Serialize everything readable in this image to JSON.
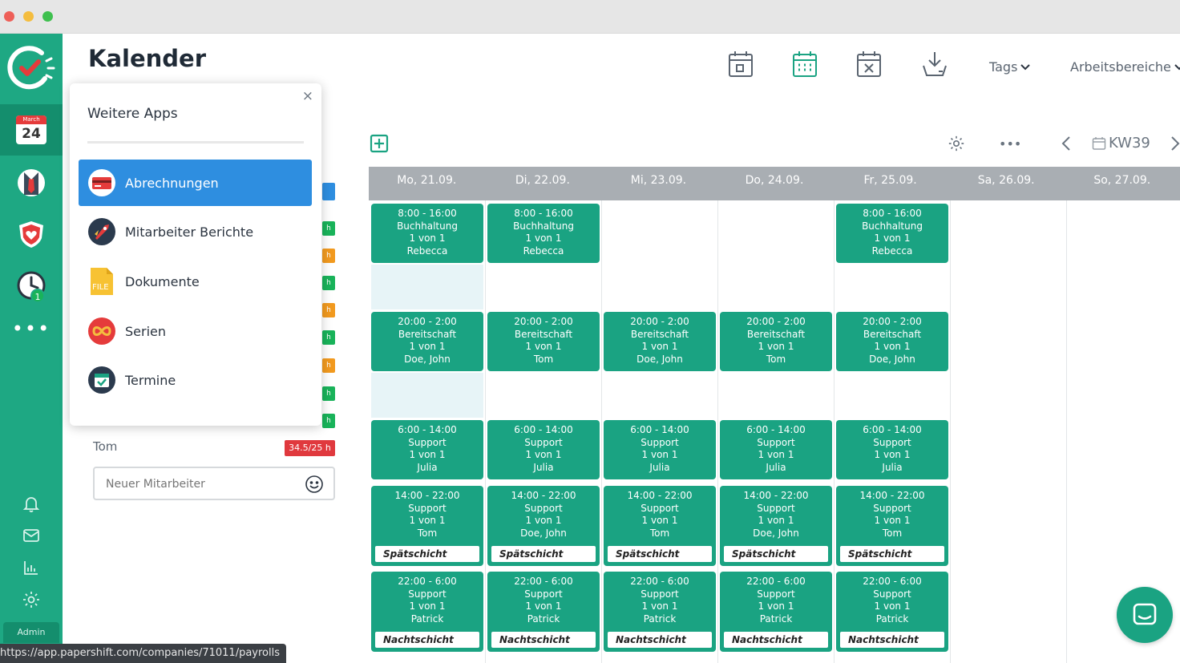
{
  "header": {
    "title": "Kalender",
    "tags_label": "Tags",
    "areas_label": "Arbeitsbereiche"
  },
  "sidebar": {
    "calendar_month": "March",
    "calendar_day": "24",
    "timer_badge": "1",
    "admin_label": "Admin"
  },
  "apps_panel": {
    "title": "Weitere Apps",
    "close": "×",
    "items": [
      {
        "label": "Abrechnungen",
        "icon": "credit-card-icon"
      },
      {
        "label": "Mitarbeiter Berichte",
        "icon": "rocket-icon"
      },
      {
        "label": "Dokumente",
        "icon": "file-icon"
      },
      {
        "label": "Serien",
        "icon": "infinity-icon"
      },
      {
        "label": "Termine",
        "icon": "calendar-check-icon"
      }
    ],
    "file_icon_text": "FILE"
  },
  "employees": {
    "visible_name": "Tom",
    "visible_hours": "34.5/25 h",
    "new_placeholder": "Neuer Mitarbeiter"
  },
  "calendar": {
    "week": "KW39",
    "days": [
      "Mo, 21.09.",
      "Di, 22.09.",
      "Mi, 23.09.",
      "Do, 24.09.",
      "Fr, 25.09.",
      "Sa, 26.09.",
      "So, 27.09."
    ],
    "rows": [
      {
        "time": "8:00 - 16:00",
        "name": "Buchhaltung",
        "tag": "",
        "cells": [
          {
            "count": "1 von 1",
            "person": "Rebecca"
          },
          {
            "count": "1 von 1",
            "person": "Rebecca"
          },
          null,
          null,
          {
            "count": "1 von 1",
            "person": "Rebecca"
          }
        ]
      },
      {
        "time": "20:00 - 2:00",
        "name": "Bereitschaft",
        "tag": "",
        "cells": [
          {
            "count": "1 von 1",
            "person": "Doe, John"
          },
          {
            "count": "1 von 1",
            "person": "Tom"
          },
          {
            "count": "1 von 1",
            "person": "Doe, John"
          },
          {
            "count": "1 von 1",
            "person": "Tom"
          },
          {
            "count": "1 von 1",
            "person": "Doe, John"
          }
        ]
      },
      {
        "time": "6:00 - 14:00",
        "name": "Support",
        "tag": "",
        "cells": [
          {
            "count": "1 von 1",
            "person": "Julia"
          },
          {
            "count": "1 von 1",
            "person": "Julia"
          },
          {
            "count": "1 von 1",
            "person": "Julia"
          },
          {
            "count": "1 von 1",
            "person": "Julia"
          },
          {
            "count": "1 von 1",
            "person": "Julia"
          }
        ]
      },
      {
        "time": "14:00 - 22:00",
        "name": "Support",
        "tag": "Spätschicht",
        "cells": [
          {
            "count": "1 von 1",
            "person": "Tom"
          },
          {
            "count": "1 von 1",
            "person": "Doe, John"
          },
          {
            "count": "1 von 1",
            "person": "Tom"
          },
          {
            "count": "1 von 1",
            "person": "Doe, John"
          },
          {
            "count": "1 von 1",
            "person": "Tom"
          }
        ]
      },
      {
        "time": "22:00 - 6:00",
        "name": "Support",
        "tag": "Nachtschicht",
        "cells": [
          {
            "count": "1 von 1",
            "person": "Patrick"
          },
          {
            "count": "1 von 1",
            "person": "Patrick"
          },
          {
            "count": "1 von 1",
            "person": "Patrick"
          },
          {
            "count": "1 von 1",
            "person": "Patrick"
          },
          {
            "count": "1 von 1",
            "person": "Patrick"
          }
        ]
      }
    ]
  },
  "status_url": "https://app.papershift.com/companies/71011/payrolls",
  "colors": {
    "brand_green": "#1ea883",
    "shift_green": "#1aa382",
    "active_blue": "#2e8ee0",
    "header_gray": "#a9aeb3",
    "over_hours_red": "#e0393e"
  }
}
